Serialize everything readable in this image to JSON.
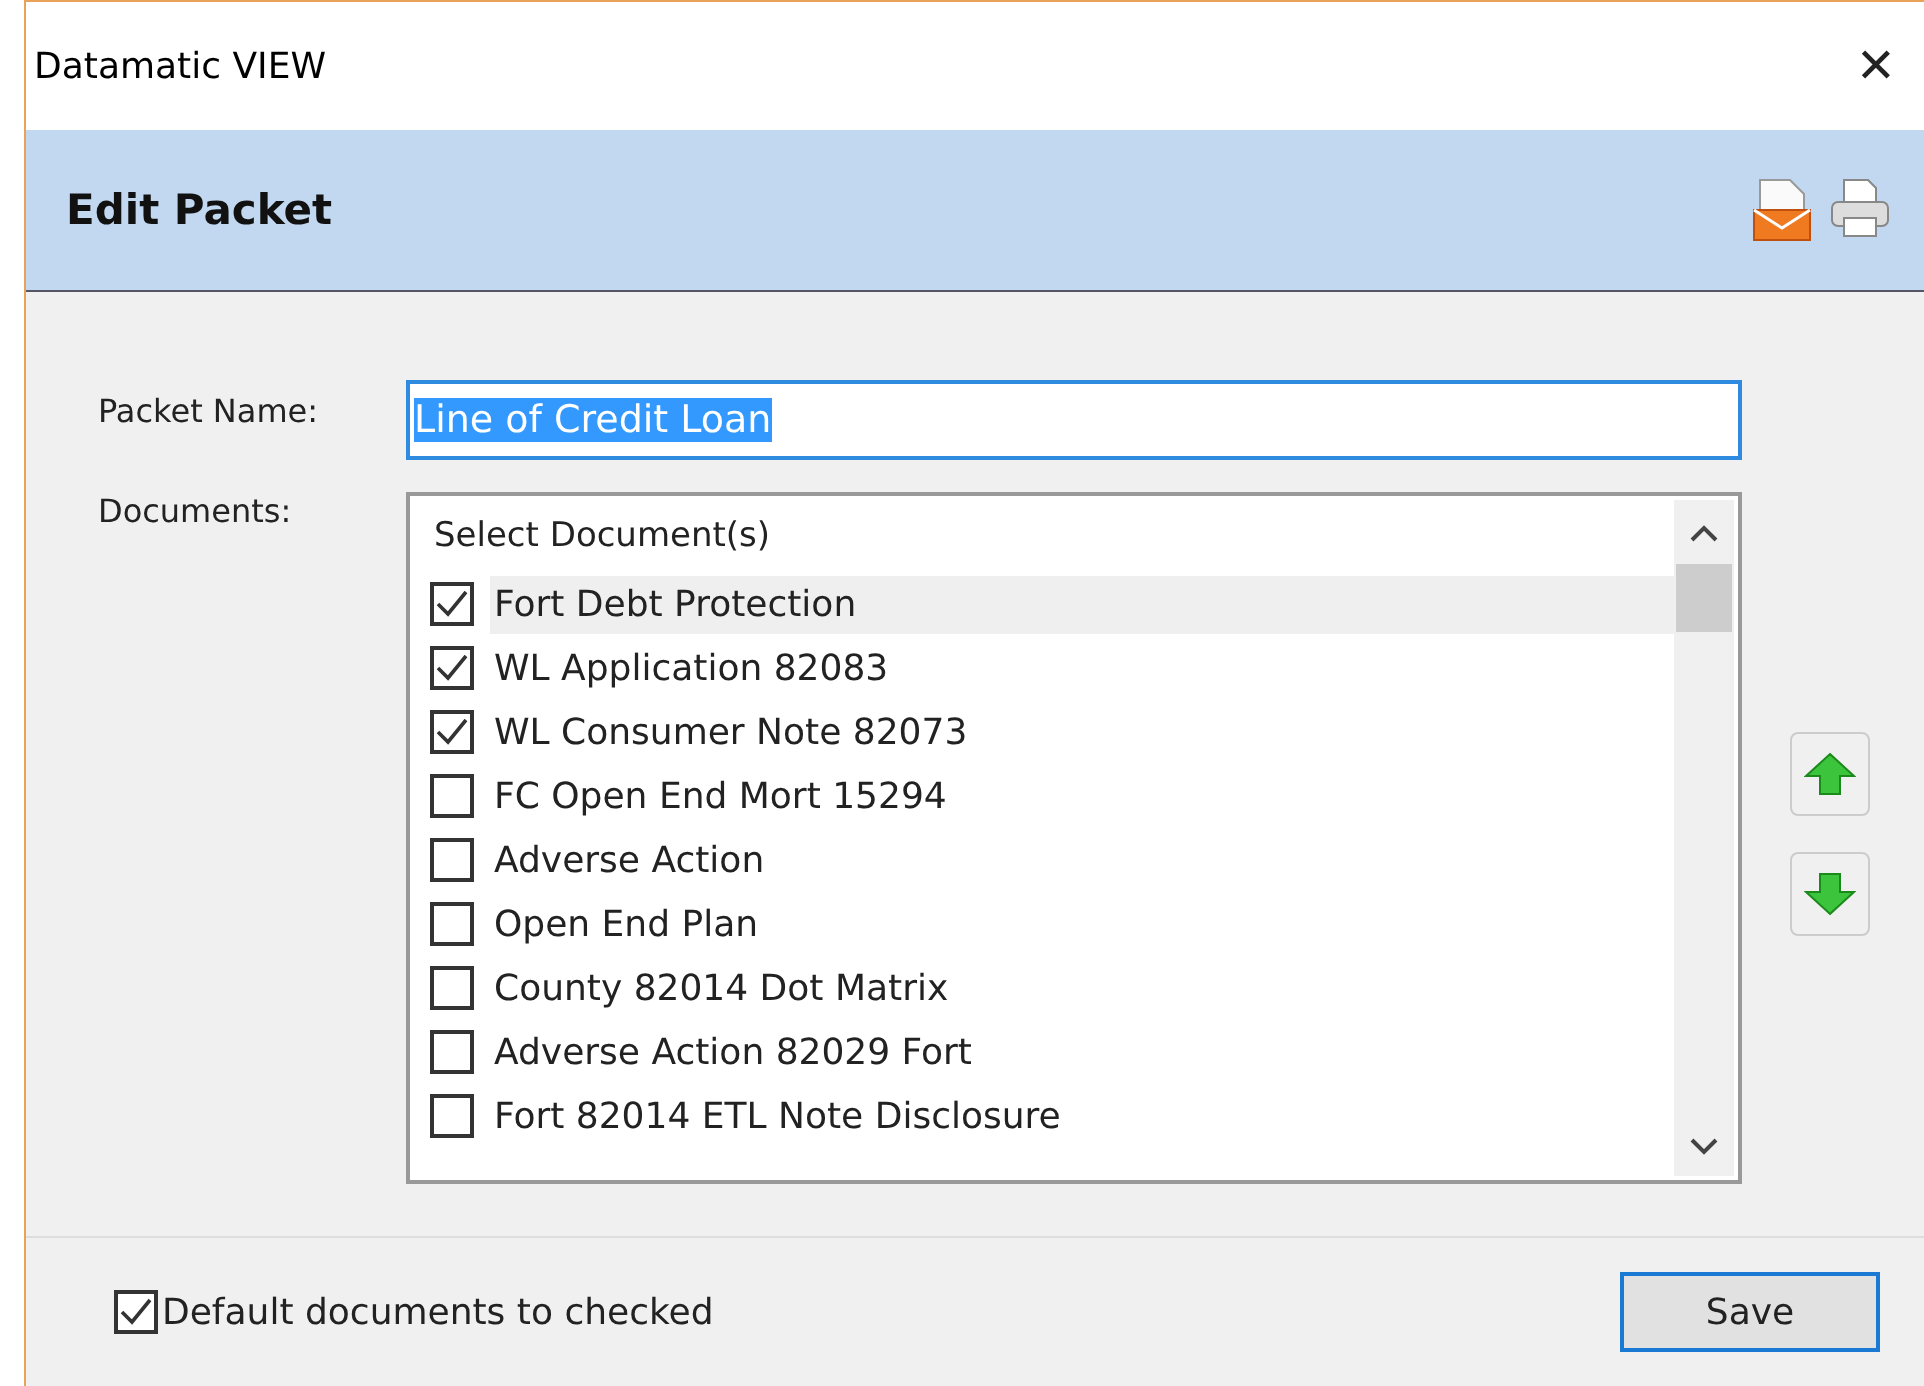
{
  "window": {
    "title": "Datamatic VIEW",
    "close": "✕"
  },
  "header": {
    "title": "Edit Packet"
  },
  "form": {
    "packet_name_label": "Packet Name:",
    "packet_name_value": "Line of Credit Loan",
    "documents_label": "Documents:"
  },
  "documents": {
    "heading": "Select Document(s)",
    "items": [
      {
        "label": "Fort Debt Protection",
        "checked": true,
        "selected": true
      },
      {
        "label": "WL Application 82083",
        "checked": true,
        "selected": false
      },
      {
        "label": "WL Consumer Note 82073",
        "checked": true,
        "selected": false
      },
      {
        "label": "FC Open End Mort 15294",
        "checked": false,
        "selected": false
      },
      {
        "label": "Adverse Action",
        "checked": false,
        "selected": false
      },
      {
        "label": "Open End Plan",
        "checked": false,
        "selected": false
      },
      {
        "label": "County 82014 Dot Matrix",
        "checked": false,
        "selected": false
      },
      {
        "label": "Adverse Action 82029 Fort",
        "checked": false,
        "selected": false
      },
      {
        "label": "Fort 82014 ETL Note Disclosure",
        "checked": false,
        "selected": false
      }
    ]
  },
  "footer": {
    "default_checked": {
      "label": "Default documents to checked",
      "checked": true
    },
    "save": "Save"
  }
}
